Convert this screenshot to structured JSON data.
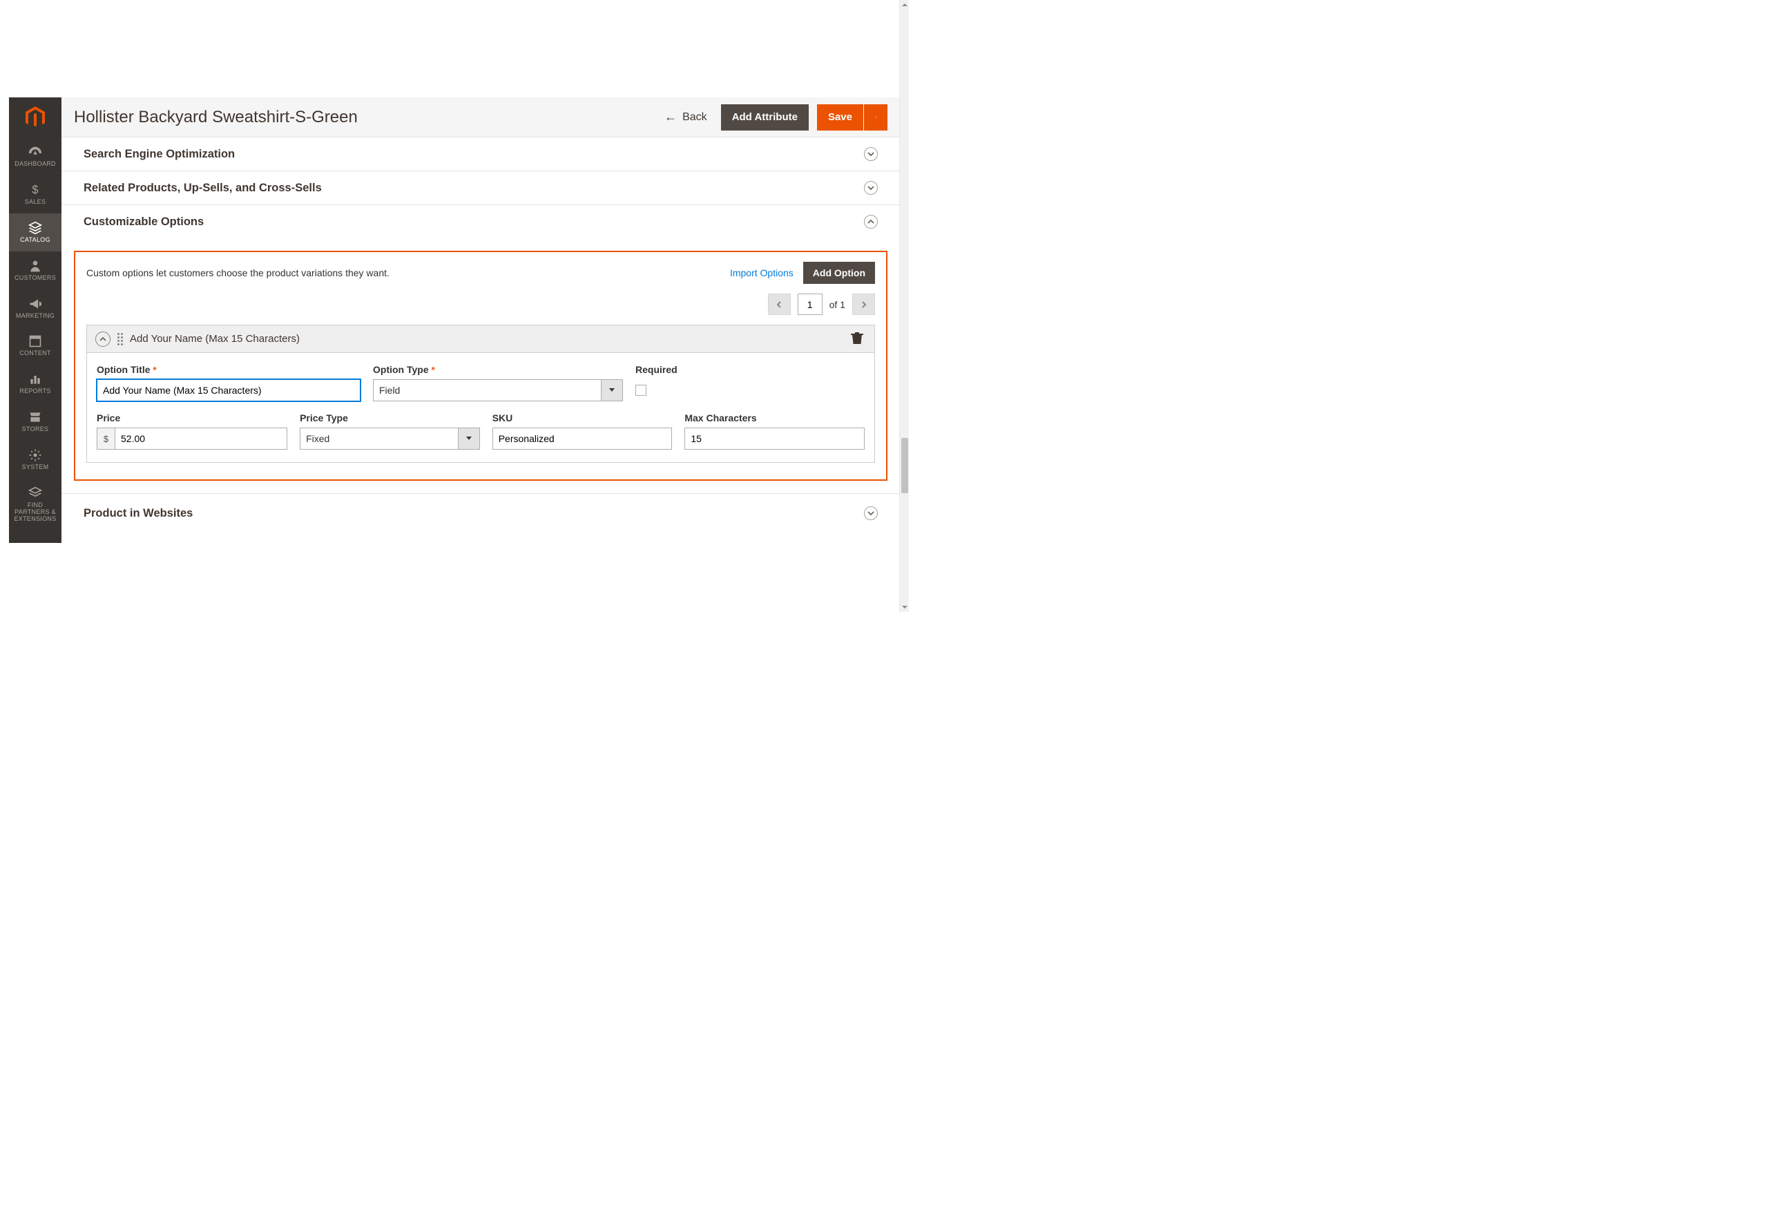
{
  "header": {
    "page_title": "Hollister Backyard Sweatshirt-S-Green",
    "back_label": "Back",
    "add_attribute_label": "Add Attribute",
    "save_label": "Save"
  },
  "sidebar": {
    "items": [
      {
        "label": "DASHBOARD"
      },
      {
        "label": "SALES"
      },
      {
        "label": "CATALOG"
      },
      {
        "label": "CUSTOMERS"
      },
      {
        "label": "MARKETING"
      },
      {
        "label": "CONTENT"
      },
      {
        "label": "REPORTS"
      },
      {
        "label": "STORES"
      },
      {
        "label": "SYSTEM"
      },
      {
        "label": "FIND PARTNERS & EXTENSIONS"
      }
    ]
  },
  "sections": {
    "seo": {
      "title": "Search Engine Optimization"
    },
    "related": {
      "title": "Related Products, Up-Sells, and Cross-Sells"
    },
    "custom": {
      "title": "Customizable Options"
    },
    "websites": {
      "title": "Product in Websites"
    }
  },
  "custom_options": {
    "description": "Custom options let customers choose the product variations they want.",
    "import_label": "Import Options",
    "add_option_label": "Add Option",
    "pager": {
      "current": "1",
      "of_label": "of 1"
    },
    "option": {
      "header_title": "Add Your Name (Max 15 Characters)",
      "labels": {
        "option_title": "Option Title",
        "option_type": "Option Type",
        "required": "Required",
        "price": "Price",
        "price_type": "Price Type",
        "sku": "SKU",
        "max_chars": "Max Characters"
      },
      "values": {
        "option_title": "Add Your Name (Max 15 Characters)",
        "option_type": "Field",
        "required": false,
        "price_symbol": "$",
        "price": "52.00",
        "price_type": "Fixed",
        "sku": "Personalized",
        "max_chars": "15"
      }
    }
  }
}
